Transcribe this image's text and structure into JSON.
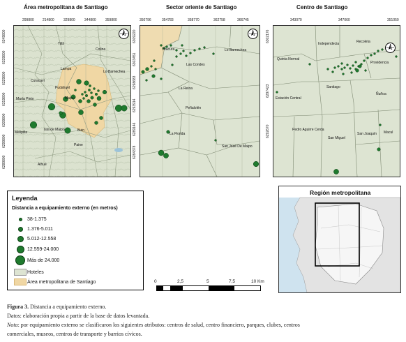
{
  "panels": {
    "amsa": {
      "title": "Área metropolitana de Santiago",
      "xticks": [
        "299800",
        "214800",
        "329800",
        "344800",
        "359800"
      ],
      "yticks": [
        "6349800",
        "6339800",
        "6329800",
        "6319800",
        "6309800",
        "6299800",
        "6289800"
      ],
      "places": [
        "Tiltil",
        "Colina",
        "Lampa",
        "Lo Barnechea",
        "Curacaví",
        "Pudahuel",
        "María Pinto",
        "Maipú",
        "Melipilla",
        "Isla de Maipo",
        "Buin",
        "Paine",
        "Alhué"
      ]
    },
    "oriente": {
      "title": "Sector oriente de Santiago",
      "xticks": [
        "350796",
        "354783",
        "358770",
        "362758",
        "366745"
      ],
      "yticks": [
        "6309220",
        "6303451",
        "6298683",
        "6293914",
        "6289146",
        "6284378"
      ],
      "places": [
        "Vitacura",
        "Lo Barnechea",
        "Las Condes",
        "La Reina",
        "Peñalolén",
        "La Florida",
        "San José De Maipo"
      ]
    },
    "centro": {
      "title": "Centro de Santiago",
      "xticks": [
        "343070",
        "347060",
        "351050"
      ],
      "yticks": [
        "6302176",
        "6297423",
        "6292670"
      ],
      "places": [
        "Independecia",
        "Recoleta",
        "Quinta Normal",
        "Providencia",
        "Santiago",
        "Ñuñoa",
        "Estación Central",
        "Pedro Aguirre Cerda",
        "San Joaquín",
        "Macul",
        "San Miguel"
      ]
    },
    "region": {
      "title": "Región metropolitana"
    }
  },
  "legend": {
    "title": "Leyenda",
    "subtitle": "Distancia a equipamiento externo (en metros)",
    "classes": [
      "38-1.375",
      "1.376-5.011",
      "5.012-12.558",
      "12.559-24.000",
      "Más de 24.000"
    ],
    "hotels": "Hoteles",
    "area": "Área metropolitana de Santiago"
  },
  "scale": {
    "labels": [
      "0",
      "2,5",
      "5",
      "7,5",
      "10 Km"
    ]
  },
  "caption": {
    "fig_label": "Figura 3.",
    "fig_text": " Distancia a equipamiento externo.",
    "source": "Datos: elaboración propia a partir de la base de datos levantada.",
    "note_label": "Nota",
    "note_text": ": por equipamiento externo se clasificaron los siguientes atributos: centros de salud, centro financiero, parques, clubes, centros",
    "note_text2": "comerciales, museos, centros de transporte y barrios cívicos."
  },
  "colors": {
    "dot": "#1f7a2e",
    "urban": "#f2d9a6",
    "map_bg": "#dfe7d4",
    "grid": "#9aa58c"
  }
}
